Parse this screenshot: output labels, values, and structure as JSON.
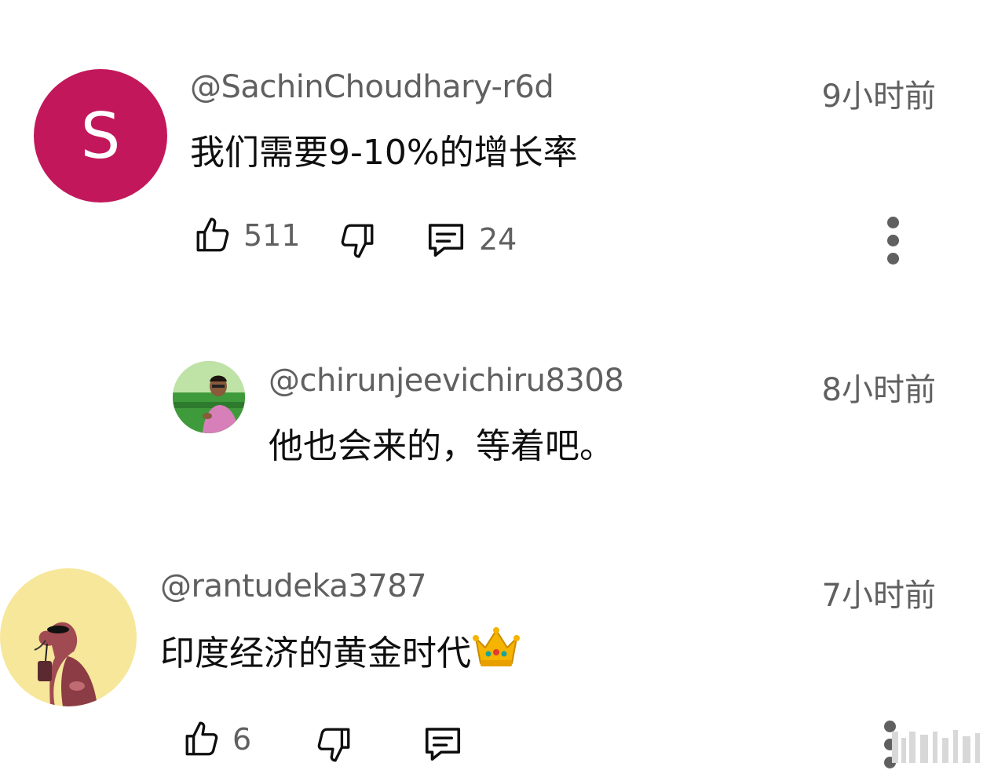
{
  "comments": [
    {
      "avatar_letter": "S",
      "avatar_color": "#c2185b",
      "handle": "@SachinChoudhary-r6d",
      "time": "9小时前",
      "text": "我们需要9-10%的增长率",
      "likes": "511",
      "replies": "24"
    },
    {
      "handle": "@chirunjeevichiru8308",
      "time": "8小时前",
      "text": "他也会来的，等着吧。"
    },
    {
      "handle": "@rantudeka3787",
      "time": "7小时前",
      "text": "印度经济的黄金时代",
      "likes": "6",
      "emoji": "crown"
    }
  ],
  "icons": {
    "like": "thumbs-up-icon",
    "dislike": "thumbs-down-icon",
    "reply": "reply-comment-icon",
    "more": "more-vertical-icon"
  },
  "colors": {
    "secondary_text": "#606060",
    "primary_text": "#0f0f0f",
    "avatar_s": "#c2185b",
    "avatar_3_bg": "#f6e79a"
  }
}
